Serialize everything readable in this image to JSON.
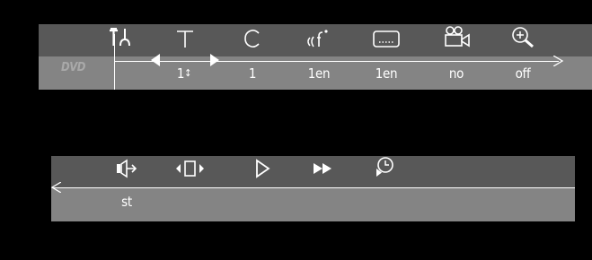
{
  "top_menu": {
    "logo_text": "DVD",
    "values": {
      "title": "1",
      "chapter": "1",
      "audio": "1en",
      "subtitle": "1en",
      "angle": "no",
      "zoom": "off"
    },
    "icons": [
      "settings-icon",
      "title-icon",
      "chapter-icon",
      "audio-icon",
      "subtitle-icon",
      "angle-icon",
      "zoom-icon"
    ]
  },
  "bottom_menu": {
    "values": {
      "sound": "st"
    },
    "icons": [
      "sound-icon",
      "frame-step-icon",
      "play-icon",
      "fast-forward-icon",
      "time-search-icon"
    ]
  },
  "colors": {
    "background": "#000000",
    "bar_dark": "#585858",
    "bar_light": "#848484",
    "foreground": "#ffffff"
  }
}
